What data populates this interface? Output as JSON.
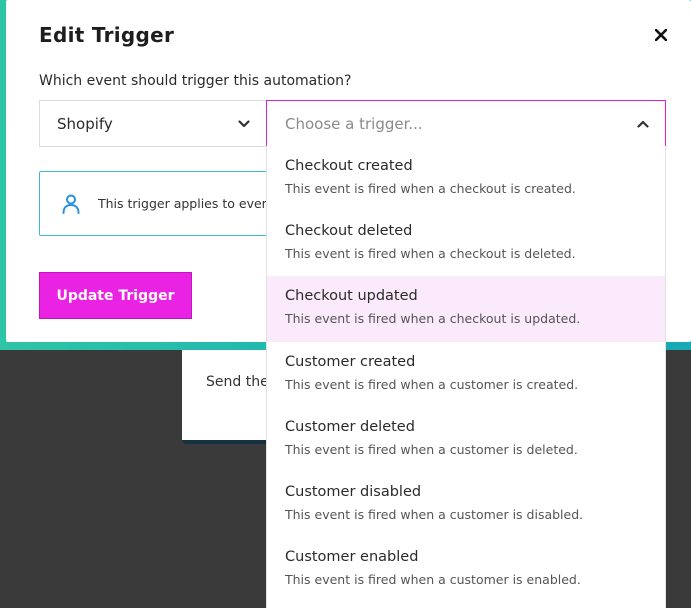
{
  "modal": {
    "title": "Edit Trigger",
    "question": "Which event should trigger this automation?",
    "app_select": {
      "value": "Shopify"
    },
    "trigger_select": {
      "placeholder": "Choose a trigger..."
    },
    "info_text": "This trigger applies to ever",
    "update_button": "Update Trigger"
  },
  "background": {
    "card_text": "Send the"
  },
  "dropdown": {
    "options": [
      {
        "title": "Checkout created",
        "description": "This event is fired when a checkout is created."
      },
      {
        "title": "Checkout deleted",
        "description": "This event is fired when a checkout is deleted."
      },
      {
        "title": "Checkout updated",
        "description": "This event is fired when a checkout is updated."
      },
      {
        "title": "Customer created",
        "description": "This event is fired when a customer is created."
      },
      {
        "title": "Customer deleted",
        "description": "This event is fired when a customer is deleted."
      },
      {
        "title": "Customer disabled",
        "description": "This event is fired when a customer is disabled."
      },
      {
        "title": "Customer enabled",
        "description": "This event is fired when a customer is enabled."
      }
    ],
    "hovered_index": 2
  },
  "colors": {
    "accent": "#ea22e3",
    "frame": "#1eb7b0",
    "info_border": "#3fb8d6",
    "hover": "#fbeafb"
  },
  "icons": {
    "close": "close-icon",
    "app_chevron": "chevron-down-icon",
    "trigger_chevron": "chevron-up-icon",
    "info": "user-icon"
  }
}
